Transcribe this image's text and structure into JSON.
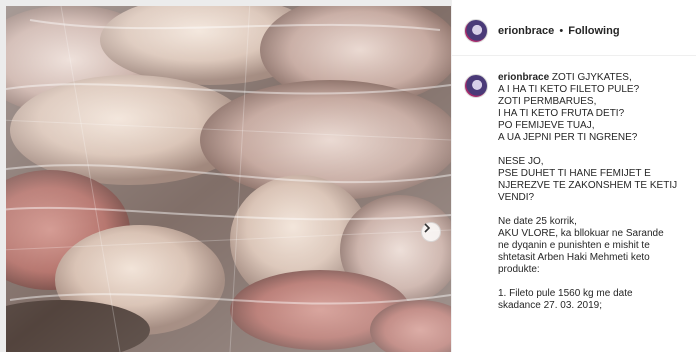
{
  "post": {
    "username": "erionbrace",
    "separator": "•",
    "follow_status": "Following"
  },
  "caption": {
    "username": "erionbrace",
    "first_line": "ZOTI GJYKATES,",
    "lines_a": [
      "A I HA TI KETO FILETO PULE?",
      "ZOTI PERMBARUES,",
      "I HA TI KETO FRUTA DETI?",
      "PO FEMIJEVE TUAJ,",
      "A UA JEPNI PER TI NGRENE?"
    ],
    "lines_b": [
      "NESE JO,",
      "PSE DUHET TI HANE FEMIJET E",
      "NJEREZVE TE ZAKONSHEM TE KETIJ",
      "VENDI?"
    ],
    "lines_c": [
      "Ne date 25 korrik,",
      "AKU VLORE, ka bllokuar ne Sarande",
      "ne dyqanin e punishten e mishit te",
      "shtetasit Arben Haki Mehmeti keto",
      "produkte:"
    ],
    "lines_d": [
      "1. Fileto pule 1560 kg me date",
      "skadance 27. 03. 2019;"
    ]
  },
  "icons": {
    "carousel": "chevron-right-icon",
    "avatar": "profile-avatar"
  }
}
